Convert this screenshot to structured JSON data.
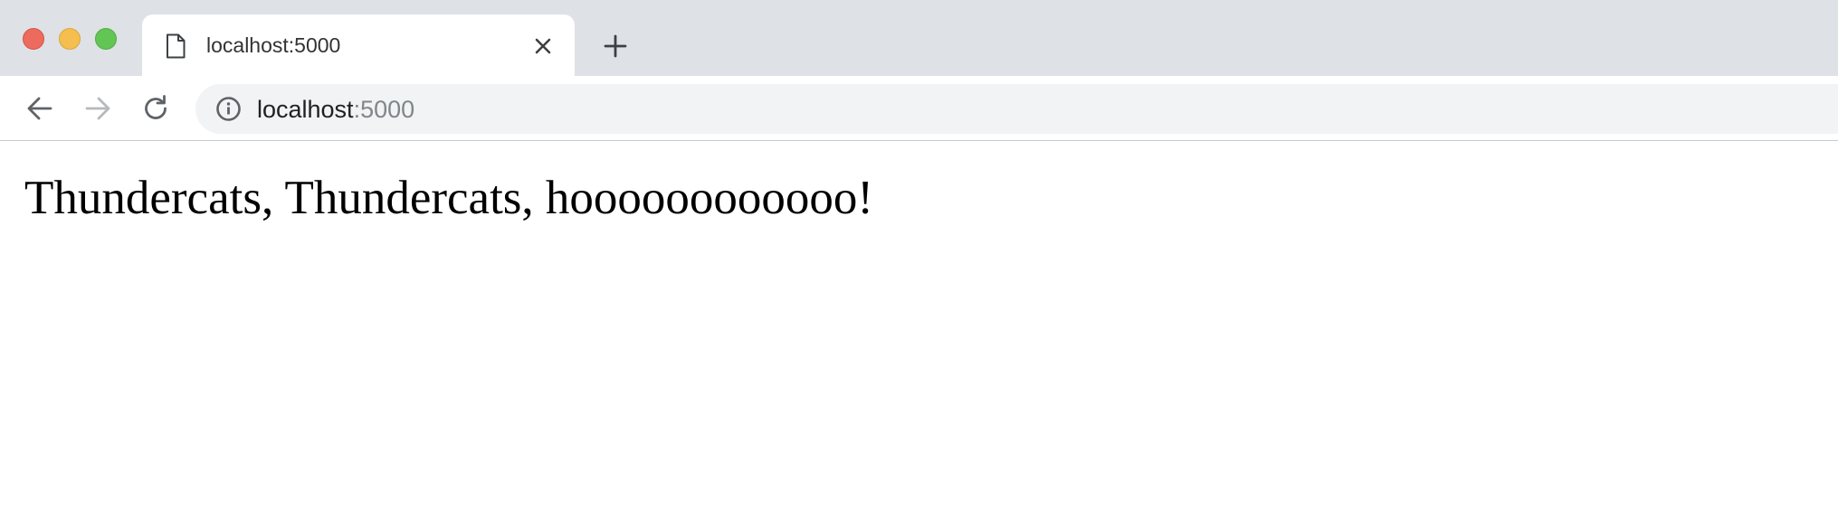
{
  "browser": {
    "tab": {
      "title": "localhost:5000",
      "favicon": "document-icon"
    },
    "address_bar": {
      "host": "localhost",
      "port": ":5000",
      "security_icon": "info-icon"
    },
    "colors": {
      "close": "#ed6a5e",
      "minimize": "#f5bf4f",
      "zoom": "#62c554",
      "tabstrip": "#dee1e6",
      "omnibox": "#f1f3f4"
    }
  },
  "page": {
    "heading": "Thundercats, Thundercats, hoooooooooooo!"
  }
}
